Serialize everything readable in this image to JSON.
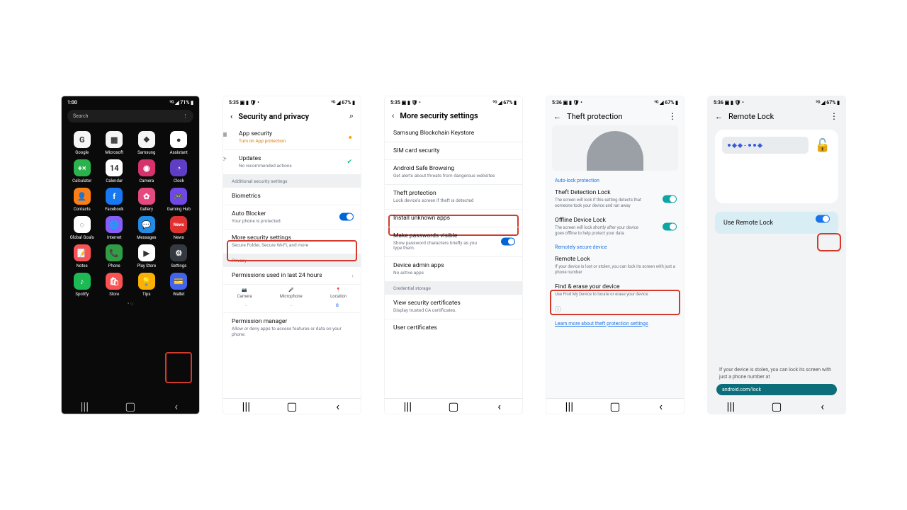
{
  "s1": {
    "time": "1:00",
    "status_right": "⁵ᴳ ◢ 71% ▮",
    "search": "Search",
    "apps": [
      {
        "n": "Google",
        "c": "#f5f5f5",
        "t": "G"
      },
      {
        "n": "Microsoft",
        "c": "#f5f5f5",
        "t": "▦"
      },
      {
        "n": "Samsung",
        "c": "#f5f5f5",
        "t": "❖"
      },
      {
        "n": "Assistant",
        "c": "#ffffff",
        "t": "●"
      },
      {
        "n": "Calculator",
        "c": "#2bb24c",
        "t": "+×"
      },
      {
        "n": "Calendar",
        "c": "#ffffff",
        "t": "14"
      },
      {
        "n": "Camera",
        "c": "#d6336c",
        "t": "◉"
      },
      {
        "n": "Clock",
        "c": "#5f3dc4",
        "t": "◔"
      },
      {
        "n": "Contacts",
        "c": "#fd7e14",
        "t": "👤"
      },
      {
        "n": "Facebook",
        "c": "#1877f2",
        "t": "f"
      },
      {
        "n": "Gallery",
        "c": "#e64980",
        "t": "✿"
      },
      {
        "n": "Gaming Hub",
        "c": "#7048e8",
        "t": "🎮"
      },
      {
        "n": "Global Goals",
        "c": "#ffffff",
        "t": "◌"
      },
      {
        "n": "Internet",
        "c": "#845ef7",
        "t": "🌐"
      },
      {
        "n": "Messages",
        "c": "#228be6",
        "t": "💬"
      },
      {
        "n": "News",
        "c": "#e03131",
        "t": "News"
      },
      {
        "n": "Notes",
        "c": "#fa5252",
        "t": "📝"
      },
      {
        "n": "Phone",
        "c": "#2f9e44",
        "t": "📞"
      },
      {
        "n": "Play Store",
        "c": "#ffffff",
        "t": "▶"
      },
      {
        "n": "Settings",
        "c": "#343a40",
        "t": "⚙"
      },
      {
        "n": "Spotify",
        "c": "#1db954",
        "t": "♪"
      },
      {
        "n": "Store",
        "c": "#fa5252",
        "t": "🛍"
      },
      {
        "n": "Tips",
        "c": "#fab005",
        "t": "💡"
      },
      {
        "n": "Wallet",
        "c": "#4263eb",
        "t": "💳"
      }
    ]
  },
  "s2": {
    "time": "5:35 ▣ ▮ 🛡 •",
    "right": "⁵ᴳ ◢ 67% ▮",
    "title": "Security and privacy",
    "app_security": "App security",
    "app_security_sub": "Turn on App protection",
    "updates": "Updates",
    "updates_sub": "No recommended actions",
    "section_additional": "Additional security settings",
    "biometrics": "Biometrics",
    "auto_blocker": "Auto Blocker",
    "auto_blocker_sub": "Your phone is protected.",
    "more": "More security settings",
    "more_sub": "Secure Folder, Secure Wi-Fi, and more",
    "section_privacy": "Privacy",
    "perms24": "Permissions used in last 24 hours",
    "camera": "Camera",
    "mic": "Microphone",
    "loc": "Location",
    "perm_mgr": "Permission manager",
    "perm_mgr_sub": "Allow or deny apps to access features or data on your phone."
  },
  "s3": {
    "time": "5:35 ▣ ▮ 🛡 •",
    "right": "⁵ᴳ ◢ 67% ▮",
    "title": "More security settings",
    "keystore": "Samsung Blockchain Keystore",
    "sim": "SIM card security",
    "safe": "Android Safe Browsing",
    "safe_sub": "Get alerts about threats from dangerous websites",
    "theft": "Theft protection",
    "theft_sub": "Lock device's screen if theft is detected",
    "unknown": "Install unknown apps",
    "pwvis": "Make passwords visible",
    "pwvis_sub": "Show password characters briefly as you type them.",
    "admin": "Device admin apps",
    "admin_sub": "No active apps",
    "section_cred": "Credential storage",
    "viewcert": "View security certificates",
    "viewcert_sub": "Display trusted CA certificates.",
    "usercert": "User certificates"
  },
  "s4": {
    "time": "5:36 ▣ ▮ 🛡 •",
    "right": "⁵ᴳ ◢ 67% ▮",
    "title": "Theft protection",
    "sh1": "Auto-lock protection",
    "tdl": "Theft Detection Lock",
    "tdl_sub": "The screen will lock if this setting detects that someone took your device and ran away",
    "odl": "Offline Device Lock",
    "odl_sub": "The screen will lock shortly after your device goes offline to help protect your data",
    "sh2": "Remotely secure device",
    "rl": "Remote Lock",
    "rl_sub": "If your device is lost or stolen, you can lock its screen with just a phone number",
    "find": "Find & erase your device",
    "find_sub": "Use Find My Device to locate or erase your device",
    "learn": "Learn more about theft protection settings"
  },
  "s5": {
    "time": "5:36 ▣ ▮ 🛡 •",
    "right": "⁵ᴳ ◢ 67% ▮",
    "title": "Remote Lock",
    "use": "Use Remote Lock",
    "help": "If your device is stolen, you can lock its screen with just a phone number at",
    "url": "android.com/lock"
  }
}
